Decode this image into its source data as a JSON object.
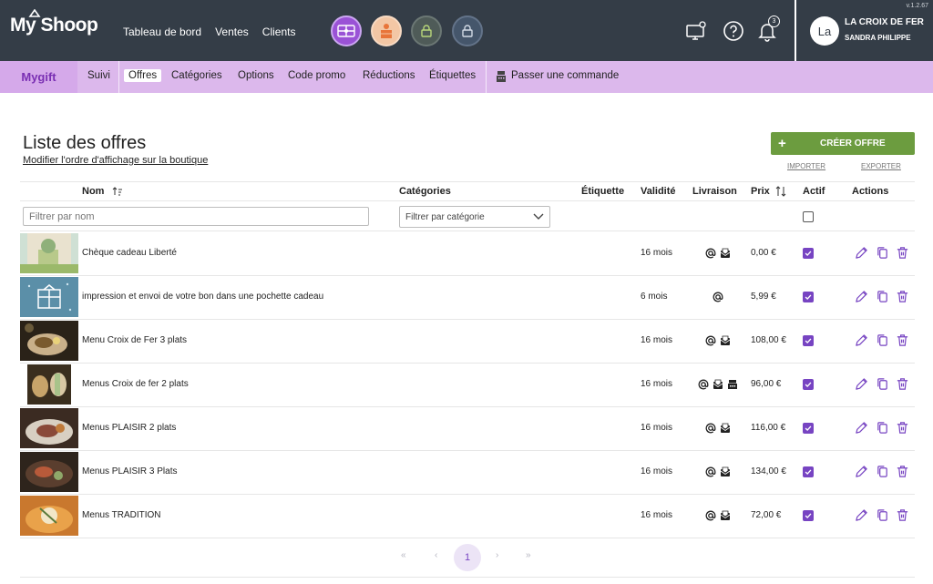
{
  "app": {
    "logo": "My Shoop",
    "version": "v.1.2.67"
  },
  "topnav": {
    "items": [
      "Tableau de bord",
      "Ventes",
      "Clients"
    ]
  },
  "user": {
    "initials": "La",
    "shop": "LA CROIX DE FER",
    "name": "SANDRA PHILIPPE",
    "notifications": "3"
  },
  "subnav": {
    "brand": "Mygift",
    "items": [
      "Suivi",
      "Offres",
      "Catégories",
      "Options",
      "Code promo",
      "Réductions",
      "Étiquettes"
    ],
    "active": "Offres",
    "order_link": "Passer une commande"
  },
  "page": {
    "title": "Liste des offres",
    "subtitle": "Modifier l'ordre d'affichage sur la boutique",
    "create_label": "CRÉER OFFRE",
    "import_label": "IMPORTER",
    "export_label": "EXPORTER"
  },
  "table": {
    "headers": {
      "name": "Nom",
      "categories": "Catégories",
      "label": "Étiquette",
      "validity": "Validité",
      "delivery": "Livraison",
      "price": "Prix",
      "active": "Actif",
      "actions": "Actions"
    },
    "filter_name_placeholder": "Filtrer par nom",
    "filter_category": "Filtrer par catégorie",
    "rows": [
      {
        "name": "Chèque cadeau Liberté",
        "validity": "16 mois",
        "price": "0,00 €",
        "delivery": [
          "email",
          "mail"
        ],
        "active": true
      },
      {
        "name": "impression et envoi de votre bon dans une pochette cadeau",
        "validity": "6 mois",
        "price": "5,99 €",
        "delivery": [
          "email"
        ],
        "active": true
      },
      {
        "name": "Menu Croix de Fer 3 plats",
        "validity": "16 mois",
        "price": "108,00 €",
        "delivery": [
          "email",
          "mail"
        ],
        "active": true
      },
      {
        "name": "Menus Croix de fer 2 plats",
        "validity": "16 mois",
        "price": "96,00 €",
        "delivery": [
          "email",
          "mail",
          "pickup"
        ],
        "active": true
      },
      {
        "name": "Menus PLAISIR 2 plats",
        "validity": "16 mois",
        "price": "116,00 €",
        "delivery": [
          "email",
          "mail"
        ],
        "active": true
      },
      {
        "name": "Menus PLAISIR 3 Plats",
        "validity": "16 mois",
        "price": "134,00 €",
        "delivery": [
          "email",
          "mail"
        ],
        "active": true
      },
      {
        "name": "Menus TRADITION",
        "validity": "16 mois",
        "price": "72,00 €",
        "delivery": [
          "email",
          "mail"
        ],
        "active": true
      }
    ]
  },
  "pagination": {
    "first": "«",
    "prev": "‹",
    "current": "1",
    "next": "›",
    "last": "»"
  },
  "colors": {
    "topbar": "#343d47",
    "subnav": "#dcb8ec",
    "brand": "#7a2fb3",
    "checkbox": "#7744c2",
    "create": "#6c9c3f"
  }
}
